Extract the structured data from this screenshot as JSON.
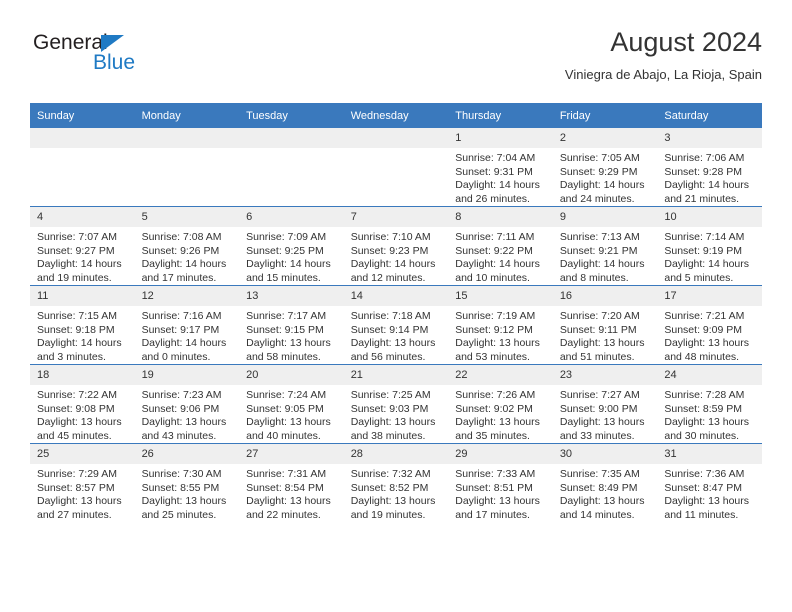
{
  "brand": {
    "name_part1": "General",
    "name_part2": "Blue",
    "accent_color": "#1f7ac4"
  },
  "header": {
    "title": "August 2024",
    "subtitle": "Viniegra de Abajo, La Rioja, Spain"
  },
  "theme": {
    "header_row_color": "#3a79bd",
    "daynum_band_color": "#efefef",
    "text_color": "#333333"
  },
  "weekdays": [
    "Sunday",
    "Monday",
    "Tuesday",
    "Wednesday",
    "Thursday",
    "Friday",
    "Saturday"
  ],
  "weeks": [
    [
      {
        "day": "",
        "empty": true
      },
      {
        "day": "",
        "empty": true
      },
      {
        "day": "",
        "empty": true
      },
      {
        "day": "",
        "empty": true
      },
      {
        "day": "1",
        "sunrise": "Sunrise: 7:04 AM",
        "sunset": "Sunset: 9:31 PM",
        "daylight": "Daylight: 14 hours and 26 minutes."
      },
      {
        "day": "2",
        "sunrise": "Sunrise: 7:05 AM",
        "sunset": "Sunset: 9:29 PM",
        "daylight": "Daylight: 14 hours and 24 minutes."
      },
      {
        "day": "3",
        "sunrise": "Sunrise: 7:06 AM",
        "sunset": "Sunset: 9:28 PM",
        "daylight": "Daylight: 14 hours and 21 minutes."
      }
    ],
    [
      {
        "day": "4",
        "sunrise": "Sunrise: 7:07 AM",
        "sunset": "Sunset: 9:27 PM",
        "daylight": "Daylight: 14 hours and 19 minutes."
      },
      {
        "day": "5",
        "sunrise": "Sunrise: 7:08 AM",
        "sunset": "Sunset: 9:26 PM",
        "daylight": "Daylight: 14 hours and 17 minutes."
      },
      {
        "day": "6",
        "sunrise": "Sunrise: 7:09 AM",
        "sunset": "Sunset: 9:25 PM",
        "daylight": "Daylight: 14 hours and 15 minutes."
      },
      {
        "day": "7",
        "sunrise": "Sunrise: 7:10 AM",
        "sunset": "Sunset: 9:23 PM",
        "daylight": "Daylight: 14 hours and 12 minutes."
      },
      {
        "day": "8",
        "sunrise": "Sunrise: 7:11 AM",
        "sunset": "Sunset: 9:22 PM",
        "daylight": "Daylight: 14 hours and 10 minutes."
      },
      {
        "day": "9",
        "sunrise": "Sunrise: 7:13 AM",
        "sunset": "Sunset: 9:21 PM",
        "daylight": "Daylight: 14 hours and 8 minutes."
      },
      {
        "day": "10",
        "sunrise": "Sunrise: 7:14 AM",
        "sunset": "Sunset: 9:19 PM",
        "daylight": "Daylight: 14 hours and 5 minutes."
      }
    ],
    [
      {
        "day": "11",
        "sunrise": "Sunrise: 7:15 AM",
        "sunset": "Sunset: 9:18 PM",
        "daylight": "Daylight: 14 hours and 3 minutes."
      },
      {
        "day": "12",
        "sunrise": "Sunrise: 7:16 AM",
        "sunset": "Sunset: 9:17 PM",
        "daylight": "Daylight: 14 hours and 0 minutes."
      },
      {
        "day": "13",
        "sunrise": "Sunrise: 7:17 AM",
        "sunset": "Sunset: 9:15 PM",
        "daylight": "Daylight: 13 hours and 58 minutes."
      },
      {
        "day": "14",
        "sunrise": "Sunrise: 7:18 AM",
        "sunset": "Sunset: 9:14 PM",
        "daylight": "Daylight: 13 hours and 56 minutes."
      },
      {
        "day": "15",
        "sunrise": "Sunrise: 7:19 AM",
        "sunset": "Sunset: 9:12 PM",
        "daylight": "Daylight: 13 hours and 53 minutes."
      },
      {
        "day": "16",
        "sunrise": "Sunrise: 7:20 AM",
        "sunset": "Sunset: 9:11 PM",
        "daylight": "Daylight: 13 hours and 51 minutes."
      },
      {
        "day": "17",
        "sunrise": "Sunrise: 7:21 AM",
        "sunset": "Sunset: 9:09 PM",
        "daylight": "Daylight: 13 hours and 48 minutes."
      }
    ],
    [
      {
        "day": "18",
        "sunrise": "Sunrise: 7:22 AM",
        "sunset": "Sunset: 9:08 PM",
        "daylight": "Daylight: 13 hours and 45 minutes."
      },
      {
        "day": "19",
        "sunrise": "Sunrise: 7:23 AM",
        "sunset": "Sunset: 9:06 PM",
        "daylight": "Daylight: 13 hours and 43 minutes."
      },
      {
        "day": "20",
        "sunrise": "Sunrise: 7:24 AM",
        "sunset": "Sunset: 9:05 PM",
        "daylight": "Daylight: 13 hours and 40 minutes."
      },
      {
        "day": "21",
        "sunrise": "Sunrise: 7:25 AM",
        "sunset": "Sunset: 9:03 PM",
        "daylight": "Daylight: 13 hours and 38 minutes."
      },
      {
        "day": "22",
        "sunrise": "Sunrise: 7:26 AM",
        "sunset": "Sunset: 9:02 PM",
        "daylight": "Daylight: 13 hours and 35 minutes."
      },
      {
        "day": "23",
        "sunrise": "Sunrise: 7:27 AM",
        "sunset": "Sunset: 9:00 PM",
        "daylight": "Daylight: 13 hours and 33 minutes."
      },
      {
        "day": "24",
        "sunrise": "Sunrise: 7:28 AM",
        "sunset": "Sunset: 8:59 PM",
        "daylight": "Daylight: 13 hours and 30 minutes."
      }
    ],
    [
      {
        "day": "25",
        "sunrise": "Sunrise: 7:29 AM",
        "sunset": "Sunset: 8:57 PM",
        "daylight": "Daylight: 13 hours and 27 minutes."
      },
      {
        "day": "26",
        "sunrise": "Sunrise: 7:30 AM",
        "sunset": "Sunset: 8:55 PM",
        "daylight": "Daylight: 13 hours and 25 minutes."
      },
      {
        "day": "27",
        "sunrise": "Sunrise: 7:31 AM",
        "sunset": "Sunset: 8:54 PM",
        "daylight": "Daylight: 13 hours and 22 minutes."
      },
      {
        "day": "28",
        "sunrise": "Sunrise: 7:32 AM",
        "sunset": "Sunset: 8:52 PM",
        "daylight": "Daylight: 13 hours and 19 minutes."
      },
      {
        "day": "29",
        "sunrise": "Sunrise: 7:33 AM",
        "sunset": "Sunset: 8:51 PM",
        "daylight": "Daylight: 13 hours and 17 minutes."
      },
      {
        "day": "30",
        "sunrise": "Sunrise: 7:35 AM",
        "sunset": "Sunset: 8:49 PM",
        "daylight": "Daylight: 13 hours and 14 minutes."
      },
      {
        "day": "31",
        "sunrise": "Sunrise: 7:36 AM",
        "sunset": "Sunset: 8:47 PM",
        "daylight": "Daylight: 13 hours and 11 minutes."
      }
    ]
  ]
}
